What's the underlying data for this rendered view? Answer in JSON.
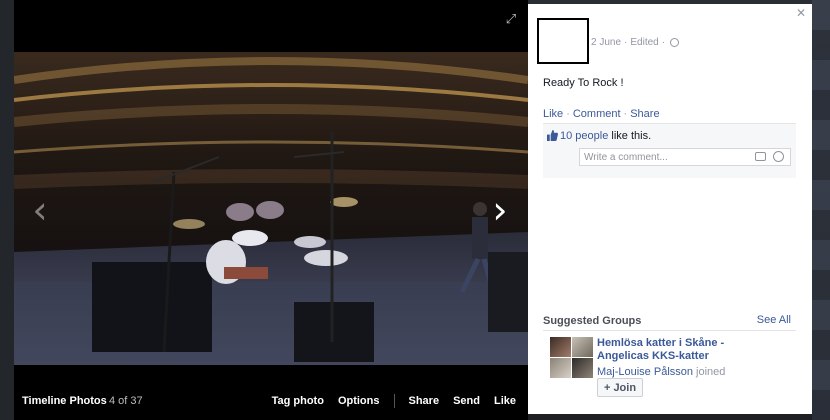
{
  "photo_bar": {
    "album_title": "Timeline Photos",
    "count": "4 of 37",
    "actions": [
      "Tag photo",
      "Options",
      "Share",
      "Send",
      "Like"
    ]
  },
  "post": {
    "date": "2 June",
    "edited": "Edited",
    "text": "Ready To Rock !",
    "actions": {
      "like": "Like",
      "comment": "Comment",
      "share": "Share"
    },
    "likes_link": "10 people",
    "likes_suffix": " like this.",
    "comment_placeholder": "Write a comment..."
  },
  "suggested_groups": {
    "title": "Suggested Groups",
    "see_all": "See All",
    "group_name": "Hemlösa katter i Skåne - Angelicas KKS-katter",
    "member_name": "Maj-Louise Pålsson",
    "member_suffix": " joined",
    "join_label": "Join"
  },
  "icons": {
    "fullscreen": "fullscreen-icon",
    "prev": "chevron-left-icon",
    "next": "chevron-right-icon",
    "close": "close-icon",
    "privacy": "globe-icon",
    "like": "thumbs-up-icon",
    "camera": "camera-icon",
    "emoji": "smiley-icon",
    "plus": "plus-icon"
  },
  "colors": {
    "link": "#3b5998",
    "muted": "#9197a3",
    "stage": "#000000"
  }
}
